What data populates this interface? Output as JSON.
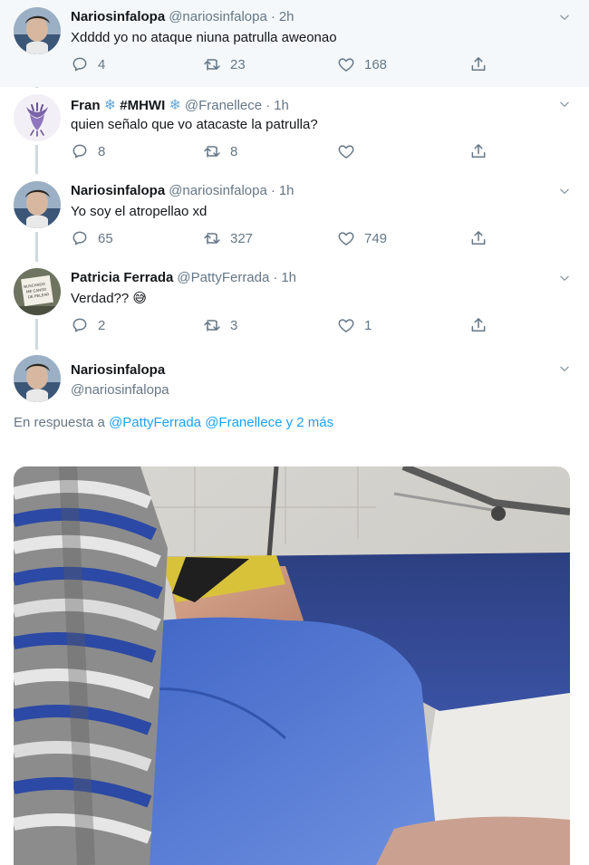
{
  "tweets": [
    {
      "name": "Nariosinfalopa",
      "name_suffix": "",
      "handle": "@nariosinfalopa",
      "time": "2h",
      "text": "Xdddd yo no ataque niuna patrulla aweonao",
      "replies": "4",
      "retweets": "23",
      "likes": "168"
    },
    {
      "name": "Fran",
      "name_suffix": "#MHWI",
      "handle": "@Franellece",
      "time": "1h",
      "text": "quien señalo que vo atacaste la patrulla?",
      "replies": "8",
      "retweets": "8",
      "likes": ""
    },
    {
      "name": "Nariosinfalopa",
      "name_suffix": "",
      "handle": "@nariosinfalopa",
      "time": "1h",
      "text": "Yo soy el atropellao xd",
      "replies": "65",
      "retweets": "327",
      "likes": "749"
    },
    {
      "name": "Patricia Ferrada",
      "name_suffix": "",
      "handle": "@PattyFerrada",
      "time": "1h",
      "text": "Verdad?? 😅",
      "replies": "2",
      "retweets": "3",
      "likes": "1"
    }
  ],
  "main_tweet": {
    "name": "Nariosinfalopa",
    "handle": "@nariosinfalopa",
    "reply_prefix": "En respuesta a",
    "reply_to_1": "@PattyFerrada",
    "reply_to_2": "@Franellece",
    "reply_more": "y 2 más"
  },
  "avatar_texts": {
    "patricia_sign": "BUSCANDO ME CANSO DE PELEAR"
  },
  "colors": {
    "link": "#1da1f2",
    "muted": "#657786",
    "highlight_bg": "#f5f8fa",
    "snowflake": "#67a7d8"
  },
  "icons": [
    "reply-icon",
    "retweet-icon",
    "like-icon",
    "share-icon",
    "chevron-down-icon",
    "snowflake-icon"
  ]
}
